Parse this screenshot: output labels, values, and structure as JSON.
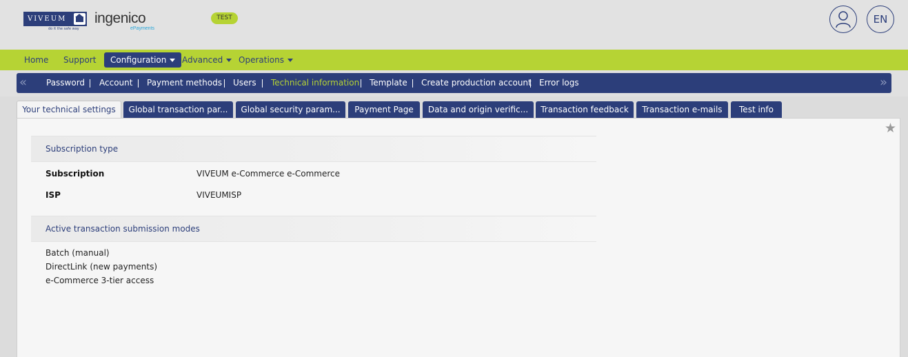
{
  "header": {
    "viveum_logo_text": "VIVEUM",
    "viveum_tagline": "do it the safe way",
    "ingenico_logo_text": "ingenico",
    "ingenico_sub": "ePayments",
    "env_badge": "TEST",
    "language": "EN"
  },
  "main_menu": [
    {
      "label": "Home"
    },
    {
      "label": "Support"
    },
    {
      "label": "Configuration"
    },
    {
      "label": "Advanced"
    },
    {
      "label": "Operations"
    }
  ],
  "sub_menu": [
    {
      "label": "Password"
    },
    {
      "label": "Account"
    },
    {
      "label": "Payment methods"
    },
    {
      "label": "Users"
    },
    {
      "label": "Technical information"
    },
    {
      "label": "Template"
    },
    {
      "label": "Create production account"
    },
    {
      "label": "Error logs"
    }
  ],
  "tabs": [
    {
      "label": "Your technical settings"
    },
    {
      "label": "Global transaction par..."
    },
    {
      "label": "Global security param..."
    },
    {
      "label": "Payment Page"
    },
    {
      "label": "Data and origin verific..."
    },
    {
      "label": "Transaction feedback"
    },
    {
      "label": "Transaction e-mails"
    },
    {
      "label": "Test info"
    }
  ],
  "subscription_section": {
    "title": "Subscription type",
    "rows": [
      {
        "label": "Subscription",
        "value": "VIVEUM e-Commerce e-Commerce"
      },
      {
        "label": "ISP",
        "value": "VIVEUMISP"
      }
    ]
  },
  "modes_section": {
    "title": "Active transaction submission modes",
    "items": [
      "Batch (manual)",
      "DirectLink (new payments)",
      "e-Commerce 3-tier access"
    ]
  },
  "colors": {
    "brand_navy": "#2c3e7a",
    "brand_green": "#b6d334"
  }
}
